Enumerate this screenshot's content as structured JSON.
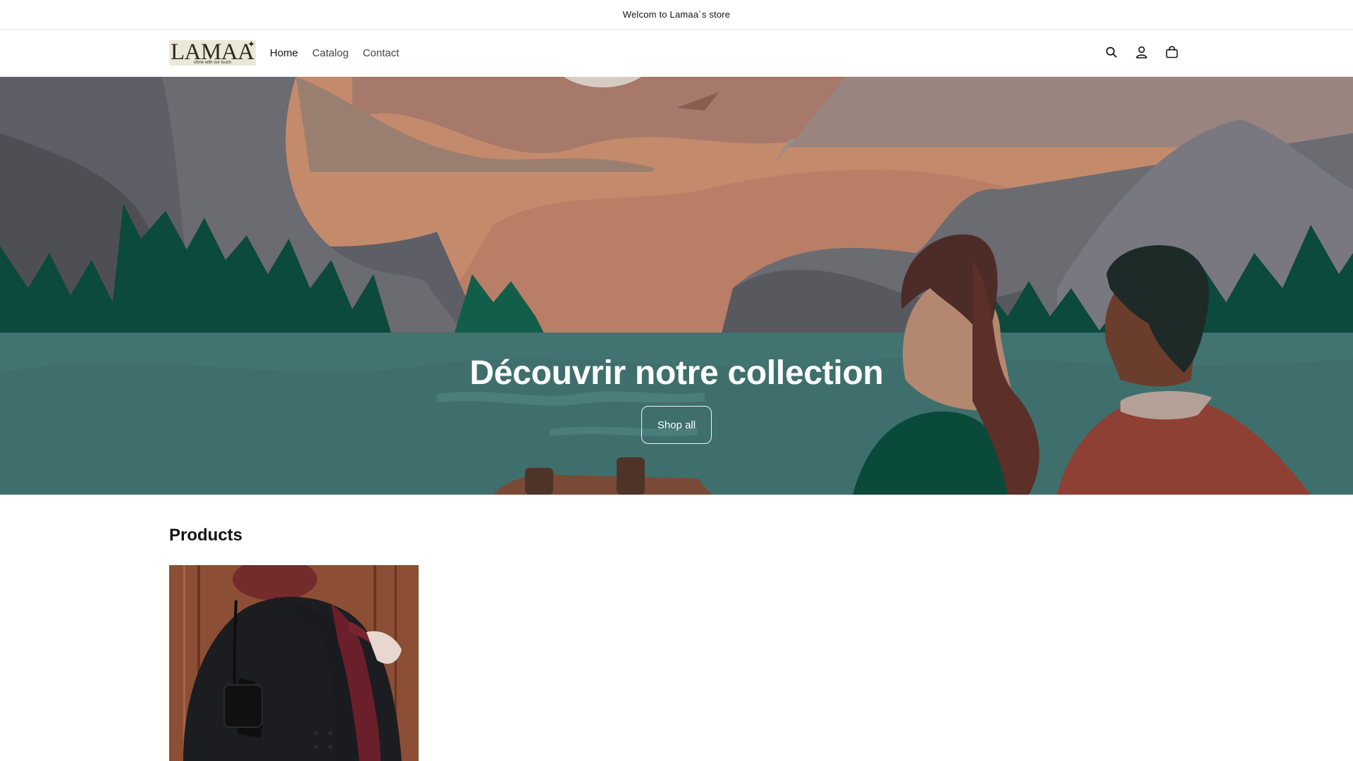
{
  "announcement": {
    "text": "Welcom to Lamaa´s store"
  },
  "header": {
    "logo": {
      "text": "LAMAA",
      "tagline": "shine with our touch",
      "star": "✦"
    },
    "nav": [
      {
        "label": "Home",
        "active": true
      },
      {
        "label": "Catalog",
        "active": false
      },
      {
        "label": "Contact",
        "active": false
      }
    ],
    "icons": [
      "search-icon",
      "account-icon",
      "cart-icon"
    ]
  },
  "hero": {
    "title": "Découvrir notre collection",
    "button_label": "Shop all"
  },
  "products": {
    "heading": "Products",
    "items": [
      {
        "image": "woman in black coat with burgundy scarf and black handbag"
      }
    ]
  },
  "colors": {
    "accent": "#121212",
    "hero_sky": "#c48a6c",
    "hero_water": "#417370",
    "hero_trees": "#0b4a3c"
  }
}
